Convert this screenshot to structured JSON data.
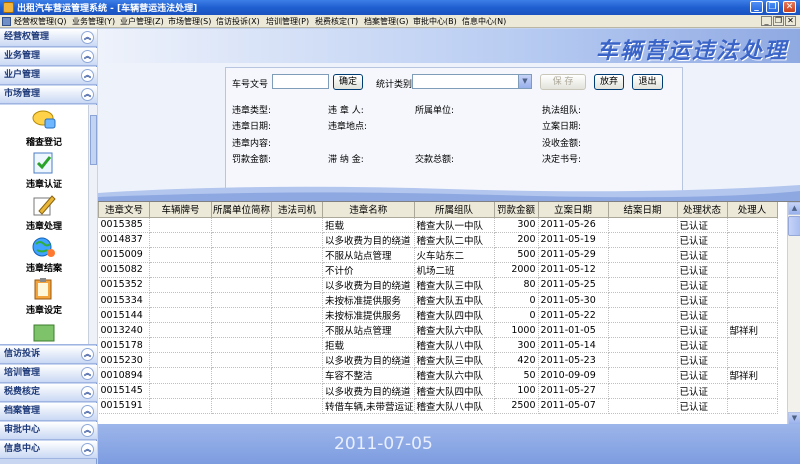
{
  "window": {
    "title": "出租汽车营运管理系统 - [车辆营运违法处理]",
    "minimize": "_",
    "restore": "❐",
    "close": "✕"
  },
  "menubar": {
    "items": [
      "经营权管理(Q)",
      "业务管理(Y)",
      "业户管理(Z)",
      "市场管理(S)",
      "信访投诉(X)",
      "培训管理(P)",
      "税费核定(T)",
      "档案管理(G)",
      "审批中心(B)",
      "信息中心(N)"
    ],
    "mdi": [
      "_",
      "❐",
      "✕"
    ]
  },
  "sidebar": {
    "top_sections": [
      "经营权管理",
      "业务管理",
      "业户管理",
      "市场管理"
    ],
    "nav_items": [
      "稽查登记",
      "违章认证",
      "违章处理",
      "违章结案",
      "违章设定"
    ],
    "bottom_sections": [
      "信访投诉",
      "培训管理",
      "税费核定",
      "档案管理",
      "审批中心",
      "信息中心"
    ],
    "chevron": "︽"
  },
  "page": {
    "title": "车辆营运违法处理",
    "date": "2011-07-05"
  },
  "form": {
    "plate_label": "车号文号",
    "plate_value": "",
    "confirm_button": "确定",
    "stat_type_label": "统计类别",
    "stat_type_value": "",
    "save_button": "保 存",
    "abandon_button": "放弃",
    "exit_button": "退出",
    "info_labels": {
      "violation_type": "违章类型:",
      "violator": "违 章 人:",
      "unit": "所属单位:",
      "enforcement_team": "执法组队:",
      "violation_date": "违章日期:",
      "violation_place": "违章地点:",
      "filing_date": "立案日期:",
      "violation_content": "违章内容:",
      "confiscation_amount": "没收金额:",
      "fine_amount": "罚款金额:",
      "late_fee": "滞 纳 金:",
      "total_payment": "交款总额:",
      "decision_no": "决定书号:"
    }
  },
  "grid": {
    "columns": [
      "违章文号",
      "车辆牌号",
      "所属单位简称",
      "违法司机",
      "违章名称",
      "所属组队",
      "罚款金额",
      "立案日期",
      "结案日期",
      "处理状态",
      "处理人"
    ],
    "rows": [
      [
        "0015385",
        "",
        "",
        "",
        "拒载",
        "稽查大队一中队",
        "300",
        "2011-05-26",
        "",
        "已认证",
        ""
      ],
      [
        "0014837",
        "",
        "",
        "",
        "以多收费为目的绕道",
        "稽查大队二中队",
        "200",
        "2011-05-19",
        "",
        "已认证",
        ""
      ],
      [
        "0015009",
        "",
        "",
        "",
        "不服从站点管理",
        "火车站东二",
        "500",
        "2011-05-29",
        "",
        "已认证",
        ""
      ],
      [
        "0015082",
        "",
        "",
        "",
        "不计价",
        "机场二班",
        "2000",
        "2011-05-12",
        "",
        "已认证",
        ""
      ],
      [
        "0015352",
        "",
        "",
        "",
        "以多收费为目的绕道",
        "稽查大队三中队",
        "80",
        "2011-05-25",
        "",
        "已认证",
        ""
      ],
      [
        "0015334",
        "",
        "",
        "",
        "未按标准提供服务",
        "稽查大队五中队",
        "0",
        "2011-05-30",
        "",
        "已认证",
        ""
      ],
      [
        "0015144",
        "",
        "",
        "",
        "未按标准提供服务",
        "稽查大队四中队",
        "0",
        "2011-05-22",
        "",
        "已认证",
        ""
      ],
      [
        "0013240",
        "",
        "",
        "",
        "不服从站点管理",
        "稽查大队六中队",
        "1000",
        "2011-01-05",
        "",
        "已认证",
        "郜祥利"
      ],
      [
        "0015178",
        "",
        "",
        "",
        "拒载",
        "稽查大队八中队",
        "300",
        "2011-05-14",
        "",
        "已认证",
        ""
      ],
      [
        "0015230",
        "",
        "",
        "",
        "以多收费为目的绕道",
        "稽查大队三中队",
        "420",
        "2011-05-23",
        "",
        "已认证",
        ""
      ],
      [
        "0010894",
        "",
        "",
        "",
        "车容不整洁",
        "稽查大队六中队",
        "50",
        "2010-09-09",
        "",
        "已认证",
        "郜祥利"
      ],
      [
        "0015145",
        "",
        "",
        "",
        "以多收费为目的绕道",
        "稽查大队四中队",
        "100",
        "2011-05-27",
        "",
        "已认证",
        ""
      ],
      [
        "0015191",
        "",
        "",
        "",
        "转借车辆,未带营运证",
        "稽查大队八中队",
        "2500",
        "2011-05-07",
        "",
        "已认证",
        ""
      ]
    ]
  },
  "colors": {
    "title_blue": "#3a64c8",
    "sidebar_bg": "#c8d6f1",
    "footer_blue": "#7d9ce0"
  }
}
